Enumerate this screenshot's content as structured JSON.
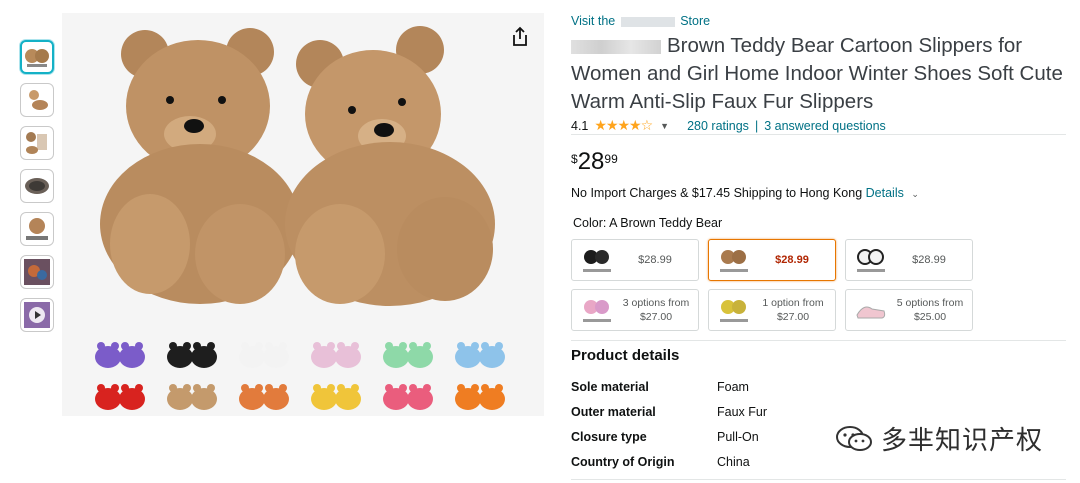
{
  "store": {
    "prefix": "Visit the",
    "suffix": "Store"
  },
  "title": "Brown Teddy Bear Cartoon Slippers for Women and Girl Home Indoor Winter Shoes Soft Cute Warm Anti-Slip Faux Fur Slippers",
  "rating": {
    "value": "4.1",
    "stars": "★★★★☆",
    "ratings": "280 ratings",
    "separator": "|",
    "answers": "3 answered questions"
  },
  "price": {
    "symbol": "$",
    "whole": "28",
    "fraction": "99"
  },
  "shipping": {
    "text": "No Import Charges & $17.45 Shipping to Hong Kong",
    "details": "Details"
  },
  "color_label": "Color: A Brown Teddy Bear",
  "options": [
    {
      "color": "#1c1c1c",
      "price": "$28.99",
      "selected": false
    },
    {
      "color": "#a97a4e",
      "price": "$28.99",
      "selected": true
    },
    {
      "color": "#2a2a2a",
      "price": "$28.99",
      "selected": false
    },
    {
      "color": "#e9a7c6",
      "line1": "3 options from",
      "line2": "$27.00",
      "selected": false
    },
    {
      "color": "#d8c23a",
      "line1": "1 option from",
      "line2": "$27.00",
      "selected": false
    },
    {
      "color": "#f0c6d0",
      "line1": "5 options from",
      "line2": "$25.00",
      "selected": false
    }
  ],
  "product_details": {
    "heading": "Product details",
    "rows": [
      {
        "key": "Sole material",
        "value": "Foam"
      },
      {
        "key": "Outer material",
        "value": "Faux Fur"
      },
      {
        "key": "Closure type",
        "value": "Pull-On"
      },
      {
        "key": "Country of Origin",
        "value": "China"
      }
    ]
  },
  "swatch_colors": [
    "#7b5cc9",
    "#1e1e1e",
    "#f3f3f3",
    "#e8c0d8",
    "#8ed9a8",
    "#8ec3ea",
    "#d8231f",
    "#c49a6c",
    "#e27b3c",
    "#f0c53a",
    "#ea5d7d",
    "#ef7d22"
  ],
  "thumb_colors": [
    "#b88a5a",
    "#c89a6a",
    "#a37a52",
    "#7a6a5a",
    "#b48458",
    "#6a5060",
    "#8a6aa8"
  ],
  "watermark": "多芈知识产权",
  "icons": {
    "share": "share-icon",
    "star": "star-icon",
    "wechat": "wechat-icon"
  }
}
